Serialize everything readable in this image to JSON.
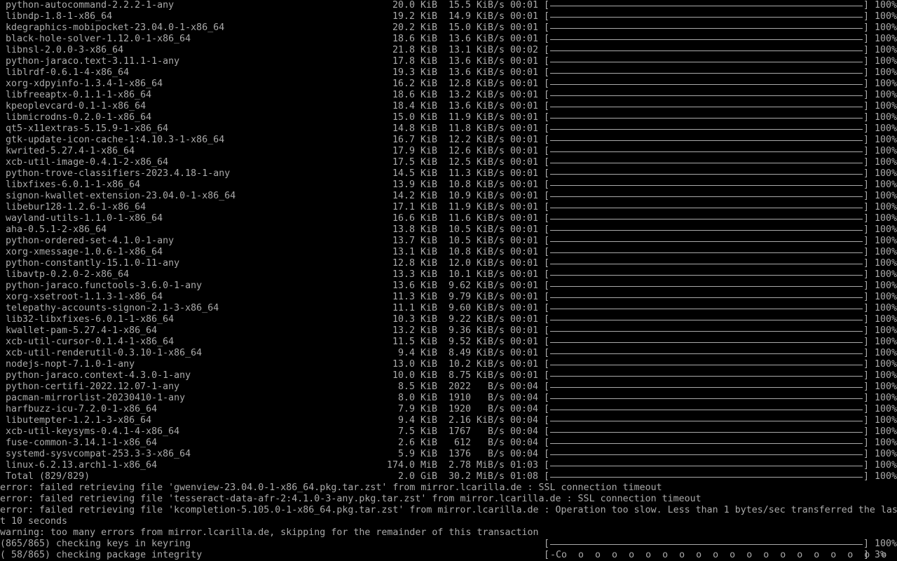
{
  "colors": {
    "background": "#000000",
    "text": "#aaaaaa"
  },
  "downloads": [
    {
      "name": "python-autocommand-2.2.2-1-any",
      "size": "20.0 KiB",
      "rate": "15.5 KiB/s",
      "time": "00:01",
      "percent": "100%",
      "progress": 1.0
    },
    {
      "name": "libndp-1.8-1-x86_64",
      "size": "19.2 KiB",
      "rate": "14.9 KiB/s",
      "time": "00:01",
      "percent": "100%",
      "progress": 1.0
    },
    {
      "name": "kdegraphics-mobipocket-23.04.0-1-x86_64",
      "size": "20.2 KiB",
      "rate": "15.0 KiB/s",
      "time": "00:01",
      "percent": "100%",
      "progress": 1.0
    },
    {
      "name": "black-hole-solver-1.12.0-1-x86_64",
      "size": "18.6 KiB",
      "rate": "13.6 KiB/s",
      "time": "00:01",
      "percent": "100%",
      "progress": 1.0
    },
    {
      "name": "libnsl-2.0.0-3-x86_64",
      "size": "21.8 KiB",
      "rate": "13.1 KiB/s",
      "time": "00:02",
      "percent": "100%",
      "progress": 1.0
    },
    {
      "name": "python-jaraco.text-3.11.1-1-any",
      "size": "17.8 KiB",
      "rate": "13.6 KiB/s",
      "time": "00:01",
      "percent": "100%",
      "progress": 1.0
    },
    {
      "name": "liblrdf-0.6.1-4-x86_64",
      "size": "19.3 KiB",
      "rate": "13.6 KiB/s",
      "time": "00:01",
      "percent": "100%",
      "progress": 1.0
    },
    {
      "name": "xorg-xdpyinfo-1.3.4-1-x86_64",
      "size": "16.2 KiB",
      "rate": "12.8 KiB/s",
      "time": "00:01",
      "percent": "100%",
      "progress": 1.0
    },
    {
      "name": "libfreeaptx-0.1.1-1-x86_64",
      "size": "18.6 KiB",
      "rate": "13.2 KiB/s",
      "time": "00:01",
      "percent": "100%",
      "progress": 1.0
    },
    {
      "name": "kpeoplevcard-0.1-1-x86_64",
      "size": "18.4 KiB",
      "rate": "13.6 KiB/s",
      "time": "00:01",
      "percent": "100%",
      "progress": 1.0
    },
    {
      "name": "libmicrodns-0.2.0-1-x86_64",
      "size": "15.0 KiB",
      "rate": "11.9 KiB/s",
      "time": "00:01",
      "percent": "100%",
      "progress": 1.0
    },
    {
      "name": "qt5-x11extras-5.15.9-1-x86_64",
      "size": "14.8 KiB",
      "rate": "11.8 KiB/s",
      "time": "00:01",
      "percent": "100%",
      "progress": 1.0
    },
    {
      "name": "gtk-update-icon-cache-1:4.10.3-1-x86_64",
      "size": "16.7 KiB",
      "rate": "12.2 KiB/s",
      "time": "00:01",
      "percent": "100%",
      "progress": 1.0
    },
    {
      "name": "kwrited-5.27.4-1-x86_64",
      "size": "17.9 KiB",
      "rate": "12.6 KiB/s",
      "time": "00:01",
      "percent": "100%",
      "progress": 1.0
    },
    {
      "name": "xcb-util-image-0.4.1-2-x86_64",
      "size": "17.5 KiB",
      "rate": "12.5 KiB/s",
      "time": "00:01",
      "percent": "100%",
      "progress": 1.0
    },
    {
      "name": "python-trove-classifiers-2023.4.18-1-any",
      "size": "14.5 KiB",
      "rate": "11.3 KiB/s",
      "time": "00:01",
      "percent": "100%",
      "progress": 1.0
    },
    {
      "name": "libxfixes-6.0.1-1-x86_64",
      "size": "13.9 KiB",
      "rate": "10.8 KiB/s",
      "time": "00:01",
      "percent": "100%",
      "progress": 1.0
    },
    {
      "name": "signon-kwallet-extension-23.04.0-1-x86_64",
      "size": "14.2 KiB",
      "rate": "10.9 KiB/s",
      "time": "00:01",
      "percent": "100%",
      "progress": 1.0
    },
    {
      "name": "libebur128-1.2.6-1-x86_64",
      "size": "17.1 KiB",
      "rate": "11.9 KiB/s",
      "time": "00:01",
      "percent": "100%",
      "progress": 1.0
    },
    {
      "name": "wayland-utils-1.1.0-1-x86_64",
      "size": "16.6 KiB",
      "rate": "11.6 KiB/s",
      "time": "00:01",
      "percent": "100%",
      "progress": 1.0
    },
    {
      "name": "aha-0.5.1-2-x86_64",
      "size": "13.8 KiB",
      "rate": "10.5 KiB/s",
      "time": "00:01",
      "percent": "100%",
      "progress": 1.0
    },
    {
      "name": "python-ordered-set-4.1.0-1-any",
      "size": "13.7 KiB",
      "rate": "10.5 KiB/s",
      "time": "00:01",
      "percent": "100%",
      "progress": 1.0
    },
    {
      "name": "xorg-xmessage-1.0.6-1-x86_64",
      "size": "13.1 KiB",
      "rate": "10.8 KiB/s",
      "time": "00:01",
      "percent": "100%",
      "progress": 1.0
    },
    {
      "name": "python-constantly-15.1.0-11-any",
      "size": "12.8 KiB",
      "rate": "12.0 KiB/s",
      "time": "00:01",
      "percent": "100%",
      "progress": 1.0
    },
    {
      "name": "libavtp-0.2.0-2-x86_64",
      "size": "13.3 KiB",
      "rate": "10.1 KiB/s",
      "time": "00:01",
      "percent": "100%",
      "progress": 1.0
    },
    {
      "name": "python-jaraco.functools-3.6.0-1-any",
      "size": "13.6 KiB",
      "rate": "9.62 KiB/s",
      "time": "00:01",
      "percent": "100%",
      "progress": 1.0
    },
    {
      "name": "xorg-xsetroot-1.1.3-1-x86_64",
      "size": "11.3 KiB",
      "rate": "9.79 KiB/s",
      "time": "00:01",
      "percent": "100%",
      "progress": 1.0
    },
    {
      "name": "telepathy-accounts-signon-2.1-3-x86_64",
      "size": "11.1 KiB",
      "rate": "9.60 KiB/s",
      "time": "00:01",
      "percent": "100%",
      "progress": 1.0
    },
    {
      "name": "lib32-libxfixes-6.0.1-1-x86_64",
      "size": "10.3 KiB",
      "rate": "9.22 KiB/s",
      "time": "00:01",
      "percent": "100%",
      "progress": 1.0
    },
    {
      "name": "kwallet-pam-5.27.4-1-x86_64",
      "size": "13.2 KiB",
      "rate": "9.36 KiB/s",
      "time": "00:01",
      "percent": "100%",
      "progress": 1.0
    },
    {
      "name": "xcb-util-cursor-0.1.4-1-x86_64",
      "size": "11.5 KiB",
      "rate": "9.52 KiB/s",
      "time": "00:01",
      "percent": "100%",
      "progress": 1.0
    },
    {
      "name": "xcb-util-renderutil-0.3.10-1-x86_64",
      "size": "9.4 KiB",
      "rate": "8.49 KiB/s",
      "time": "00:01",
      "percent": "100%",
      "progress": 1.0
    },
    {
      "name": "nodejs-nopt-7.1.0-1-any",
      "size": "13.0 KiB",
      "rate": "10.2 KiB/s",
      "time": "00:01",
      "percent": "100%",
      "progress": 1.0
    },
    {
      "name": "python-jaraco.context-4.3.0-1-any",
      "size": "10.0 KiB",
      "rate": "8.75 KiB/s",
      "time": "00:01",
      "percent": "100%",
      "progress": 1.0
    },
    {
      "name": "python-certifi-2022.12.07-1-any",
      "size": "8.5 KiB",
      "rate": "2022   B/s",
      "time": "00:04",
      "percent": "100%",
      "progress": 1.0
    },
    {
      "name": "pacman-mirrorlist-20230410-1-any",
      "size": "8.0 KiB",
      "rate": "1910   B/s",
      "time": "00:04",
      "percent": "100%",
      "progress": 1.0
    },
    {
      "name": "harfbuzz-icu-7.2.0-1-x86_64",
      "size": "7.9 KiB",
      "rate": "1920   B/s",
      "time": "00:04",
      "percent": "100%",
      "progress": 1.0
    },
    {
      "name": "libutempter-1.2.1-3-x86_64",
      "size": "9.4 KiB",
      "rate": "2.16 KiB/s",
      "time": "00:04",
      "percent": "100%",
      "progress": 1.0
    },
    {
      "name": "xcb-util-keysyms-0.4.1-4-x86_64",
      "size": "7.5 KiB",
      "rate": "1767   B/s",
      "time": "00:04",
      "percent": "100%",
      "progress": 1.0
    },
    {
      "name": "fuse-common-3.14.1-1-x86_64",
      "size": "2.6 KiB",
      "rate": "612   B/s",
      "time": "00:04",
      "percent": "100%",
      "progress": 1.0
    },
    {
      "name": "systemd-sysvcompat-253.3-3-x86_64",
      "size": "5.9 KiB",
      "rate": "1376   B/s",
      "time": "00:04",
      "percent": "100%",
      "progress": 1.0
    },
    {
      "name": "linux-6.2.13.arch1-1-x86_64",
      "size": "174.0 MiB",
      "rate": "2.78 MiB/s",
      "time": "01:03",
      "percent": "100%",
      "progress": 1.0
    }
  ],
  "total": {
    "label": "Total (829/829)",
    "size": "2.0 GiB",
    "rate": "30.2 MiB/s",
    "time": "01:08",
    "percent": "100%",
    "progress": 1.0
  },
  "errors": [
    "error: failed retrieving file 'gwenview-23.04.0-1-x86_64.pkg.tar.zst' from mirror.lcarilla.de : SSL connection timeout",
    "error: failed retrieving file 'tesseract-data-afr-2:4.1.0-3-any.pkg.tar.zst' from mirror.lcarilla.de : SSL connection timeout"
  ],
  "wrapped_error": {
    "line1": "error: failed retrieving file 'kcompletion-5.105.0-1-x86_64.pkg.tar.zst' from mirror.lcarilla.de : Operation too slow. Less than 1 bytes/sec transferred the las",
    "line2": "t 10 seconds"
  },
  "warning": "warning: too many errors from mirror.lcarilla.de, skipping for the remainder of this transaction",
  "keyring": {
    "label": "(865/865) checking keys in keyring",
    "percent": "100%",
    "progress": 1.0
  },
  "integrity": {
    "label": "( 58/865) checking package integrity",
    "bar_text": "-Co  o  o  o  o  o  o  o  o  o  o  o  o  o  o  o  o  o  o  o  o  o  o",
    "percent": "3%"
  }
}
